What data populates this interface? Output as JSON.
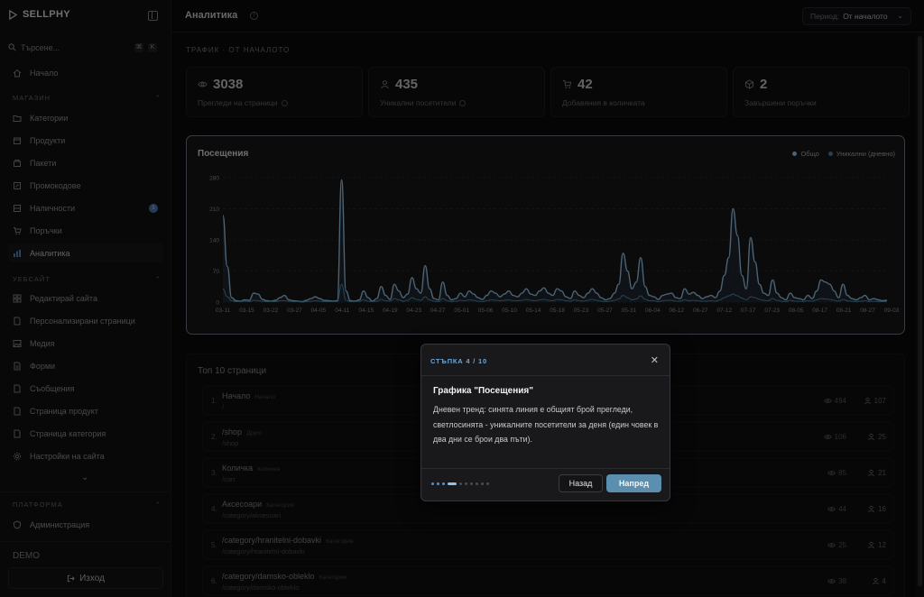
{
  "sidebar": {
    "brand": "SELLPHY",
    "search_placeholder": "Търсене...",
    "search_keys": [
      "⌘",
      "K"
    ],
    "home": "Начало",
    "shop_section": "МАГАЗИН",
    "shop_items": [
      {
        "label": "Категории",
        "icon": "folder-icon"
      },
      {
        "label": "Продукти",
        "icon": "box-icon"
      },
      {
        "label": "Пакети",
        "icon": "package-icon"
      },
      {
        "label": "Промокодове",
        "icon": "tag-icon"
      },
      {
        "label": "Наличности",
        "icon": "stock-icon",
        "badge": "1"
      },
      {
        "label": "Поръчки",
        "icon": "cart-icon"
      },
      {
        "label": "Аналитика",
        "icon": "analytics-icon",
        "active": true
      }
    ],
    "site_section": "УЕБСАЙТ",
    "site_items": [
      {
        "label": "Редактирай сайта",
        "icon": "grid-icon"
      },
      {
        "label": "Персонализирани страници",
        "icon": "page-icon"
      },
      {
        "label": "Медия",
        "icon": "image-icon"
      },
      {
        "label": "Форми",
        "icon": "form-icon"
      },
      {
        "label": "Съобщения",
        "icon": "message-icon"
      },
      {
        "label": "Страница продукт",
        "icon": "product-page-icon"
      },
      {
        "label": "Страница категория",
        "icon": "category-page-icon"
      },
      {
        "label": "Настройки на сайта",
        "icon": "gear-icon"
      }
    ],
    "platform_section": "ПЛАТФОРМА",
    "platform_items": [
      {
        "label": "Администрация",
        "icon": "shield-icon"
      }
    ],
    "env": "DEMO",
    "logout": "Изход"
  },
  "header": {
    "title": "Аналитика",
    "period_label": "Период:",
    "period_value": "От началото"
  },
  "traffic": {
    "section_title": "ТРАФИК · ОТ НАЧАЛОТО",
    "stats": [
      {
        "value": "3038",
        "label": "Прегледи на страници",
        "icon": "eye-icon"
      },
      {
        "value": "435",
        "label": "Уникални посетители",
        "icon": "user-icon"
      },
      {
        "value": "42",
        "label": "Добавяния в количката",
        "icon": "cart-icon"
      },
      {
        "value": "2",
        "label": "Завършени поръчки",
        "icon": "cube-icon"
      }
    ]
  },
  "chart_data": {
    "type": "line",
    "title": "Посещения",
    "legend": [
      "Общо",
      "Уникални (дневно)"
    ],
    "legend_position": "top-right",
    "ylim": [
      0,
      280
    ],
    "yticks": [
      0,
      70,
      140,
      210,
      280
    ],
    "grid": true,
    "xticks": [
      "03-11",
      "03-15",
      "03-22",
      "03-27",
      "04-05",
      "04-11",
      "04-15",
      "04-19",
      "04-23",
      "04-27",
      "05-01",
      "05-06",
      "05-10",
      "05-14",
      "05-18",
      "05-23",
      "05-27",
      "05-31",
      "06-04",
      "06-12",
      "06-27",
      "07-12",
      "07-17",
      "07-23",
      "08-05",
      "08-17",
      "08-21",
      "08-27",
      "09-03"
    ],
    "colors": {
      "total": "#9fd0f2",
      "unique": "#4f8aa8"
    },
    "series": [
      {
        "name": "Общо",
        "values": [
          195,
          80,
          10,
          3,
          2,
          5,
          4,
          20,
          18,
          6,
          3,
          2,
          4,
          10,
          15,
          5,
          3,
          2,
          1,
          4,
          8,
          12,
          8,
          4,
          3,
          2,
          3,
          275,
          25,
          3,
          2,
          5,
          25,
          10,
          2,
          8,
          35,
          15,
          6,
          40,
          25,
          10,
          18,
          55,
          30,
          20,
          82,
          30,
          8,
          5,
          45,
          15,
          5,
          8,
          20,
          12,
          25,
          18,
          10,
          6,
          15,
          25,
          20,
          12,
          18,
          25,
          15,
          12,
          20,
          30,
          18,
          15,
          25,
          32,
          20,
          15,
          30,
          25,
          12,
          8,
          25,
          15,
          10,
          20,
          30,
          20,
          10,
          5,
          8,
          20,
          40,
          110,
          70,
          30,
          45,
          100,
          35,
          15,
          12,
          6,
          15,
          18,
          20,
          10,
          8,
          30,
          18,
          22,
          15,
          8,
          12,
          15,
          10,
          25,
          60,
          100,
          210,
          150,
          60,
          30,
          145,
          90,
          40,
          20,
          15,
          50,
          20,
          10,
          5,
          20,
          10,
          8,
          5,
          15,
          8,
          25,
          50,
          45,
          40,
          25,
          10,
          40,
          15,
          8,
          5,
          10,
          15,
          5,
          8,
          5,
          3,
          4
        ]
      },
      {
        "name": "Уникални (дневно)",
        "values": [
          30,
          12,
          3,
          1,
          1,
          2,
          1,
          4,
          3,
          2,
          1,
          1,
          1,
          3,
          3,
          2,
          1,
          1,
          0,
          1,
          2,
          3,
          2,
          1,
          1,
          1,
          1,
          40,
          4,
          1,
          1,
          2,
          5,
          2,
          1,
          2,
          6,
          3,
          2,
          8,
          5,
          2,
          4,
          10,
          6,
          4,
          12,
          5,
          2,
          1,
          8,
          3,
          1,
          2,
          4,
          3,
          5,
          4,
          2,
          1,
          3,
          5,
          4,
          3,
          4,
          5,
          3,
          3,
          4,
          6,
          4,
          3,
          5,
          6,
          4,
          3,
          6,
          5,
          3,
          2,
          5,
          3,
          2,
          4,
          6,
          4,
          2,
          1,
          2,
          4,
          7,
          15,
          10,
          5,
          7,
          14,
          6,
          3,
          3,
          1,
          3,
          4,
          4,
          2,
          2,
          5,
          3,
          4,
          3,
          2,
          2,
          3,
          2,
          5,
          10,
          14,
          18,
          14,
          9,
          5,
          12,
          10,
          6,
          4,
          3,
          8,
          4,
          2,
          1,
          4,
          2,
          2,
          1,
          3,
          2,
          5,
          8,
          7,
          6,
          4,
          2,
          6,
          3,
          2,
          1,
          2,
          3,
          1,
          2,
          1,
          1,
          1
        ]
      }
    ]
  },
  "top_pages": {
    "title": "Топ 10 страници",
    "rows": [
      {
        "rank": "1.",
        "title": "Начало",
        "tag": "Начало",
        "path": "/",
        "views": "494",
        "users": "107"
      },
      {
        "rank": "2.",
        "title": "/shop",
        "tag": "Друго",
        "path": "/shop",
        "views": "106",
        "users": "25"
      },
      {
        "rank": "3.",
        "title": "Количка",
        "tag": "Количка",
        "path": "/cart",
        "views": "85",
        "users": "21"
      },
      {
        "rank": "4.",
        "title": "Аксесоари",
        "tag": "Категория",
        "path": "/category/aksesoari",
        "views": "44",
        "users": "16"
      },
      {
        "rank": "5.",
        "title": "/category/hranitelni-dobavki",
        "tag": "Категория",
        "path": "/category/hranitelni-dobavki",
        "views": "25",
        "users": "12"
      },
      {
        "rank": "6.",
        "title": "/category/damsko-obleklo",
        "tag": "Категория",
        "path": "/category/damsko-obleklo",
        "views": "38",
        "users": "4"
      }
    ]
  },
  "tour": {
    "step": "СТЪПКА 4 / 10",
    "title": "Графика \"Посещения\"",
    "body": "Дневен тренд: синята линия е общият брой прегледи, светлосинята - уникалните посетители за деня (един човек в два дни се брои два пъти).",
    "back": "Назад",
    "next": "Напред",
    "total_steps": 10,
    "current_step": 4
  }
}
